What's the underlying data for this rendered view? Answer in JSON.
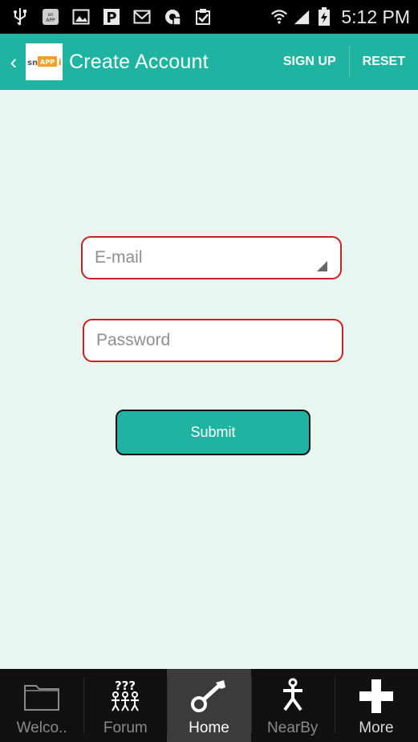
{
  "status_bar": {
    "time": "5:12 PM",
    "left_icons": [
      "usb-icon",
      "snappii-app-icon",
      "gallery-icon",
      "parking-icon",
      "gmail-icon",
      "app-store-icon",
      "clipboard-check-icon"
    ],
    "right_icons": [
      "wifi-icon",
      "signal-icon",
      "battery-charging-icon"
    ]
  },
  "action_bar": {
    "back_icon": "chevron-left-icon",
    "logo_text": "snAPPii",
    "title": "Create Account",
    "sign_up_label": "SIGN UP",
    "reset_label": "RESET",
    "color": "#1fb4a2"
  },
  "form": {
    "email_placeholder": "E-mail",
    "email_value": "",
    "password_placeholder": "Password",
    "password_value": "",
    "submit_label": "Submit",
    "field_border_color": "#cc1f1f"
  },
  "tabs": [
    {
      "label": "Welco..",
      "icon": "folder-icon",
      "active": false
    },
    {
      "label": "Forum",
      "icon": "forum-people-icon",
      "active": false
    },
    {
      "label": "Home",
      "icon": "key-icon",
      "active": true
    },
    {
      "label": "NearBy",
      "icon": "walking-person-icon",
      "active": false
    },
    {
      "label": "More",
      "icon": "plus-icon",
      "active": false
    }
  ]
}
